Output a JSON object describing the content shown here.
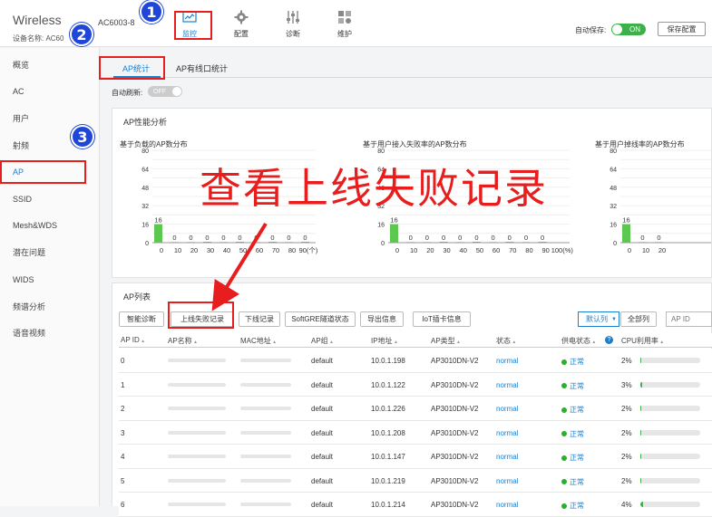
{
  "header": {
    "brand": "Wireless",
    "model": "AC6003-8",
    "device_label": "设备名称: AC60",
    "nav": [
      {
        "label": "监控",
        "icon": "monitor-icon"
      },
      {
        "label": "配置",
        "icon": "gear-icon"
      },
      {
        "label": "诊断",
        "icon": "sliders-icon"
      },
      {
        "label": "维护",
        "icon": "maintenance-icon"
      }
    ],
    "autosave_label": "自动保存:",
    "autosave_state": "ON",
    "save_button": "保存配置"
  },
  "markers": [
    "1",
    "2",
    "3"
  ],
  "sidebar": {
    "items": [
      "概览",
      "AC",
      "用户",
      "射频",
      "AP",
      "SSID",
      "Mesh&WDS",
      "潜在问题",
      "WIDS",
      "频谱分析",
      "语音视频"
    ]
  },
  "tabs": [
    "AP统计",
    "AP有线口统计"
  ],
  "autorefresh": {
    "label": "自动刷新:",
    "state": "OFF"
  },
  "perf_panel": {
    "title": "AP性能分析"
  },
  "overlay_text": "查看上线失败记录",
  "chart_data": [
    {
      "type": "bar",
      "title": "基于负载的AP数分布",
      "x_ticks": [
        "0",
        "10",
        "20",
        "30",
        "40",
        "50",
        "60",
        "70",
        "80",
        "90(个)"
      ],
      "values": [
        16,
        0,
        0,
        0,
        0,
        0,
        0,
        0,
        0,
        0
      ],
      "ylim": [
        0,
        80
      ],
      "y_ticks": [
        "0",
        "8",
        "16",
        "24",
        "32",
        "40",
        "48",
        "56",
        "64",
        "72",
        "80"
      ]
    },
    {
      "type": "bar",
      "title": "基于用户接入失败率的AP数分布",
      "x_ticks": [
        "0",
        "10",
        "20",
        "30",
        "40",
        "50",
        "60",
        "70",
        "80",
        "90",
        "100(%)"
      ],
      "values": [
        16,
        0,
        0,
        0,
        0,
        0,
        0,
        0,
        0,
        0
      ],
      "ylim": [
        0,
        80
      ],
      "y_ticks": [
        "0",
        "8",
        "16",
        "24",
        "32",
        "40",
        "48",
        "56",
        "64",
        "72",
        "80"
      ]
    },
    {
      "type": "bar",
      "title": "基于用户掉线率的AP数分布",
      "x_ticks": [
        "0",
        "10",
        "20"
      ],
      "values": [
        16,
        0,
        0
      ],
      "ylim": [
        0,
        80
      ],
      "y_ticks": [
        "0",
        "8",
        "16",
        "24",
        "32",
        "40",
        "48",
        "56",
        "64",
        "72",
        "80"
      ]
    }
  ],
  "ap_list": {
    "title": "AP列表",
    "buttons": [
      "智能诊断",
      "上线失败记录",
      "下线记录",
      "SoftGRE隧道状态",
      "导出信息",
      "IoT插卡信息"
    ],
    "column_select": "默认列",
    "all_columns": "全部列",
    "search_placeholder": "AP ID",
    "columns": [
      "AP ID",
      "AP名称",
      "MAC地址",
      "AP组",
      "IP地址",
      "AP类型",
      "状态",
      "供电状态",
      "CPU利用率"
    ],
    "rows": [
      {
        "id": "0",
        "group": "default",
        "ip": "10.0.1.198",
        "type": "AP3010DN-V2",
        "status": "normal",
        "power": "正常",
        "cpu": "2%"
      },
      {
        "id": "1",
        "group": "default",
        "ip": "10.0.1.122",
        "type": "AP3010DN-V2",
        "status": "normal",
        "power": "正常",
        "cpu": "3%"
      },
      {
        "id": "2",
        "group": "default",
        "ip": "10.0.1.226",
        "type": "AP3010DN-V2",
        "status": "normal",
        "power": "正常",
        "cpu": "2%"
      },
      {
        "id": "3",
        "group": "default",
        "ip": "10.0.1.208",
        "type": "AP3010DN-V2",
        "status": "normal",
        "power": "正常",
        "cpu": "2%"
      },
      {
        "id": "4",
        "group": "default",
        "ip": "10.0.1.147",
        "type": "AP3010DN-V2",
        "status": "normal",
        "power": "正常",
        "cpu": "2%"
      },
      {
        "id": "5",
        "group": "default",
        "ip": "10.0.1.219",
        "type": "AP3010DN-V2",
        "status": "normal",
        "power": "正常",
        "cpu": "2%"
      },
      {
        "id": "6",
        "group": "default",
        "ip": "10.0.1.214",
        "type": "AP3010DN-V2",
        "status": "normal",
        "power": "正常",
        "cpu": "4%"
      }
    ]
  },
  "colors": {
    "accent": "#1b7fcf",
    "bar": "#5cc84f",
    "highlight": "#e81e1e",
    "marker": "#1f46d8"
  }
}
